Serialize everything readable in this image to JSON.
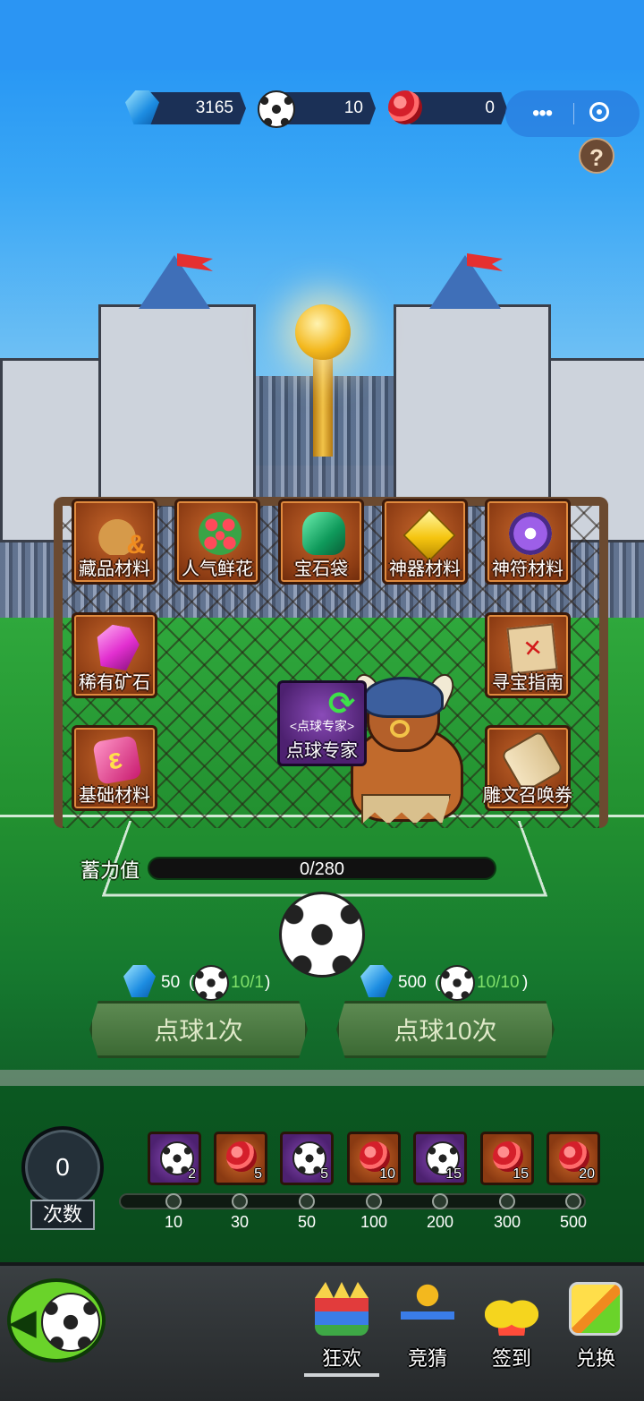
{
  "currencies": [
    {
      "icon": "gem-icon",
      "value": "3165"
    },
    {
      "icon": "soccer-ball-icon",
      "value": "10"
    },
    {
      "icon": "rose-icon",
      "value": "0"
    }
  ],
  "help_label": "?",
  "rewards_grid": [
    {
      "label": "藏品材料",
      "icon": "material-bag-icon"
    },
    {
      "label": "人气鲜花",
      "icon": "flower-bouquet-icon"
    },
    {
      "label": "宝石袋",
      "icon": "gem-bag-icon"
    },
    {
      "label": "神器材料",
      "icon": "yellow-gem-icon"
    },
    {
      "label": "神符材料",
      "icon": "rune-icon"
    },
    {
      "label": "稀有矿石",
      "icon": "pink-gem-icon"
    },
    {
      "label": "寻宝指南",
      "icon": "treasure-map-icon"
    },
    {
      "label": "基础材料",
      "icon": "basic-material-icon"
    },
    {
      "label": "雕文召唤券",
      "icon": "scroll-icon"
    }
  ],
  "expert": {
    "small_label": "<点球专家>",
    "label": "点球专家"
  },
  "charge": {
    "label": "蓄力值",
    "value_text": "0/280",
    "fraction": 0
  },
  "kicks": [
    {
      "cost": "50",
      "open": "(",
      "balls": "10/1",
      "close": ")",
      "button": "点球1次"
    },
    {
      "cost": "500",
      "open": "(",
      "balls": "10/10",
      "close": ")",
      "button": "点球10次"
    }
  ],
  "count": {
    "value": "0",
    "label": "次数"
  },
  "milestone_rewards": [
    {
      "type": "ball",
      "qty": "2"
    },
    {
      "type": "rose",
      "qty": "5"
    },
    {
      "type": "ball",
      "qty": "5"
    },
    {
      "type": "rose",
      "qty": "10"
    },
    {
      "type": "ball",
      "qty": "15"
    },
    {
      "type": "rose",
      "qty": "15"
    },
    {
      "type": "rose",
      "qty": "20"
    }
  ],
  "milestones": [
    "10",
    "30",
    "50",
    "100",
    "200",
    "300",
    "500"
  ],
  "nav": [
    {
      "label": "狂欢",
      "icon": "carnival-crown-icon",
      "active": true
    },
    {
      "label": "竞猜",
      "icon": "guess-bracket-icon",
      "active": false
    },
    {
      "label": "签到",
      "icon": "sign-in-shoes-icon",
      "active": false
    },
    {
      "label": "兑换",
      "icon": "exchange-icon",
      "active": false
    }
  ],
  "colors": {
    "sky": "#2b95f3",
    "field": "#229030",
    "button_green": "#5d8a52",
    "tile_orange": "#8e3d14",
    "tile_purple": "#4d2170"
  }
}
